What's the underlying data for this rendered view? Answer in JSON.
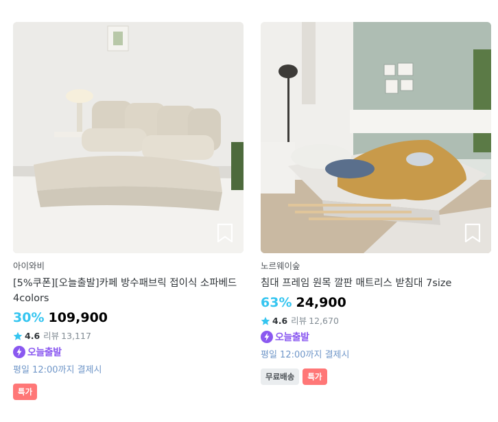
{
  "products": [
    {
      "brand": "아이와비",
      "title": "[5%쿠폰][오늘출발]카페 방수패브릭 접이식 소파베드 4colors",
      "discount": "30%",
      "price": "109,900",
      "rating": "4.6",
      "review_label": "리뷰",
      "review_count": "13,117",
      "express_label": "오늘출발",
      "delivery_note": "평일 12:00까지 결제시",
      "badges": [
        "특가"
      ],
      "image_desc_icon": "sofa-bed-image"
    },
    {
      "brand": "노르웨이숲",
      "title": "침대 프레임 원목 깔판 매트리스 받침대 7size",
      "discount": "63%",
      "price": "24,900",
      "rating": "4.6",
      "review_label": "리뷰",
      "review_count": "12,670",
      "express_label": "오늘출발",
      "delivery_note": "평일 12:00까지 결제시",
      "badges": [
        "무료배송",
        "특가"
      ],
      "image_desc_icon": "bed-frame-image"
    }
  ],
  "colors": {
    "discount": "#35c5f0",
    "express": "#8a58f0",
    "delivery": "#6f96c8",
    "sale_badge": "#ff7777",
    "free_badge": "#eaedef",
    "star": "#35c5f0"
  }
}
